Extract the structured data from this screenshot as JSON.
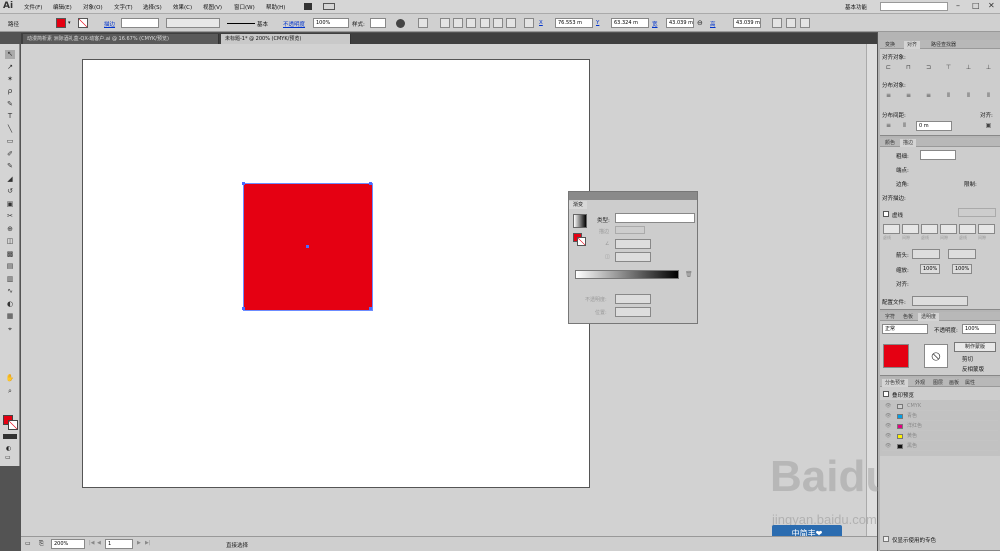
{
  "app": {
    "logo": "Ai",
    "workspace": "基本功能",
    "search_placeholder": ""
  },
  "menu": [
    "文件(F)",
    "编辑(E)",
    "对象(O)",
    "文字(T)",
    "选择(S)",
    "效果(C)",
    "视图(V)",
    "窗口(W)",
    "帮助(H)"
  ],
  "control_bar": {
    "selection_label": "路径",
    "stroke_label": "描边",
    "brush_label": "基本",
    "opacity_label": "不透明度",
    "opacity_value": "100%",
    "style_label": "样式:",
    "x_label": "X",
    "x_value": "76.553 m",
    "y_label": "Y",
    "y_value": "63.324 m",
    "w_label": "宽",
    "w_value": "43.039 m",
    "h_label": "高",
    "h_value": "43.039 m"
  },
  "doc_tabs": [
    "动漫简析素 洲际酒礼盒-QX-动客户.ai @ 16.67% (CMYK/预览)",
    "未标题-1* @ 200% (CMYK/预览)"
  ],
  "tools": [
    "↖",
    "↗",
    "✶",
    "ρ",
    "✎",
    "T",
    "╲",
    "▭",
    "✐",
    "✎",
    "◢",
    "↺",
    "▣",
    "✂",
    "⊕",
    "◫",
    "▩",
    "▤",
    "▥",
    "∿",
    "◐",
    "▦",
    "⌖",
    "✋",
    "⌕"
  ],
  "colors": {
    "fill": "#e50012",
    "canvas_bg": "#d2d2d2",
    "panel_bg": "#cdcdcd",
    "selection": "#4a6cff"
  },
  "gradient_panel": {
    "title": "渐变",
    "type_label": "类型:",
    "type_value": "",
    "stroke_label": "描边",
    "angle_label": "∠",
    "ratio_label": "◫",
    "opacity_label": "不透明度:",
    "location_label": "位置:"
  },
  "align_panel": {
    "tabs": [
      "变换",
      "对齐",
      "路径查找器"
    ],
    "align_objects": "对齐对象:",
    "distribute_objects": "分布对象:",
    "distribute_spacing": "分布间距:",
    "align_to": "对齐:",
    "spacing_value": "0 m"
  },
  "stroke_panel": {
    "tabs": [
      "颜色",
      "描边"
    ],
    "weight_label": "粗细:",
    "cap_label": "端点:",
    "corner_label": "边角:",
    "limit_label": "限制:",
    "align_label": "对齐描边:",
    "dashed_label": "虚线",
    "dash_cells": [
      "虚线",
      "间隙",
      "虚线",
      "间隙",
      "虚线",
      "间隙"
    ],
    "arrow_label": "箭头:",
    "scale_label": "缩放:",
    "scale1": "100%",
    "scale2": "100%",
    "align2_label": "对齐:",
    "profile_label": "配置文件:"
  },
  "transparency_panel": {
    "tabs": [
      "字符",
      "色板",
      "透明度"
    ],
    "mode": "正常",
    "opacity_label": "不透明度:",
    "opacity_value": "100%",
    "mask_button": "制作蒙版",
    "clip": "剪切",
    "invert": "反相蒙版"
  },
  "separations_panel": {
    "tabs": [
      "分色预览",
      "外观",
      "图层",
      "画板",
      "属性"
    ],
    "overprint": "叠印预览",
    "rows": [
      {
        "name": "CMYK",
        "color": "#cfcfcf"
      },
      {
        "name": "青色",
        "color": "#00a0e9"
      },
      {
        "name": "洋红色",
        "color": "#e4007f"
      },
      {
        "name": "黄色",
        "color": "#fff100"
      },
      {
        "name": "黑色",
        "color": "#111111"
      }
    ],
    "spot_only": "仅显示使用的专色"
  },
  "status_bar": {
    "zoom": "200%",
    "artboard_num": "1",
    "tool_status": "直接选择"
  },
  "watermark": {
    "text": "Baidu经验",
    "url": "jingyan.baidu.com",
    "badge": "中简丰❤"
  }
}
